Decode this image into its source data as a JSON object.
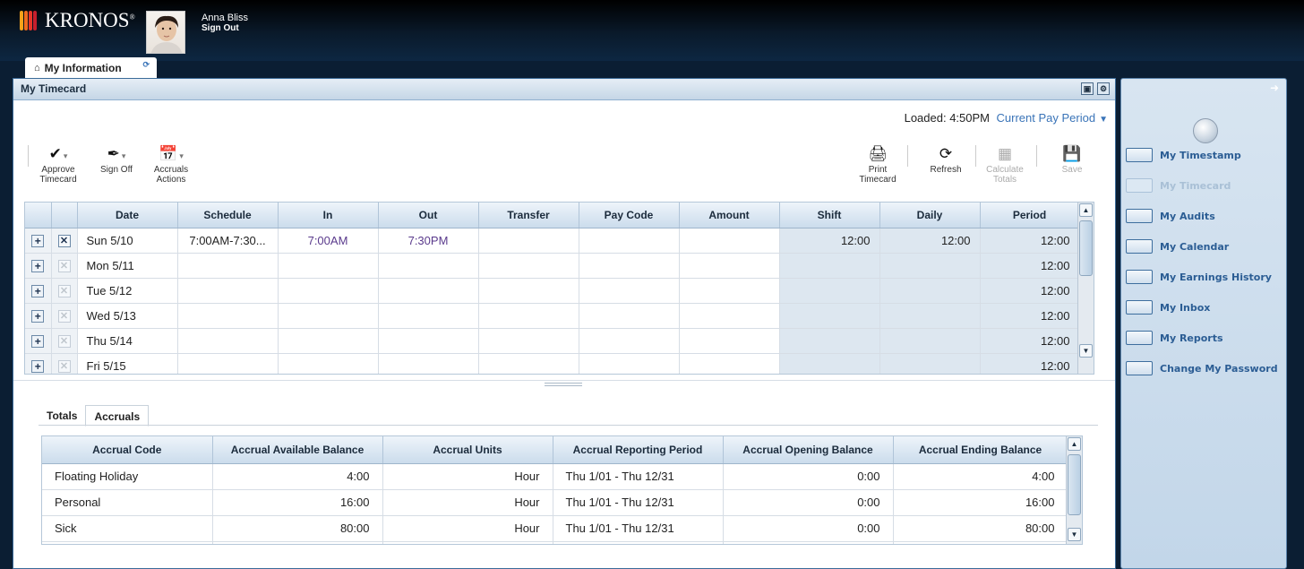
{
  "header": {
    "logo_text": "KRONOS",
    "logo_mark": "®",
    "user_name": "Anna Bliss",
    "sign_out": "Sign Out"
  },
  "workspace_tab": {
    "label": "My Information"
  },
  "frame": {
    "title": "My Timecard",
    "loaded": "Loaded: 4:50PM",
    "period": "Current Pay Period"
  },
  "toolbar": {
    "approve": "Approve Timecard",
    "signoff": "Sign Off",
    "accruals": "Accruals Actions",
    "print": "Print Timecard",
    "refresh": "Refresh",
    "calculate": "Calculate Totals",
    "save": "Save"
  },
  "timecard": {
    "headers": [
      "Date",
      "Schedule",
      "In",
      "Out",
      "Transfer",
      "Pay Code",
      "Amount",
      "Shift",
      "Daily",
      "Period"
    ],
    "rows": [
      {
        "date": "Sun 5/10",
        "schedule": "7:00AM-7:30...",
        "in": "7:00AM",
        "out": "7:30PM",
        "transfer": "",
        "paycode": "",
        "amount": "",
        "shift": "12:00",
        "daily": "12:00",
        "period": "12:00"
      },
      {
        "date": "Mon 5/11",
        "schedule": "",
        "in": "",
        "out": "",
        "transfer": "",
        "paycode": "",
        "amount": "",
        "shift": "",
        "daily": "",
        "period": "12:00"
      },
      {
        "date": "Tue 5/12",
        "schedule": "",
        "in": "",
        "out": "",
        "transfer": "",
        "paycode": "",
        "amount": "",
        "shift": "",
        "daily": "",
        "period": "12:00"
      },
      {
        "date": "Wed 5/13",
        "schedule": "",
        "in": "",
        "out": "",
        "transfer": "",
        "paycode": "",
        "amount": "",
        "shift": "",
        "daily": "",
        "period": "12:00"
      },
      {
        "date": "Thu 5/14",
        "schedule": "",
        "in": "",
        "out": "",
        "transfer": "",
        "paycode": "",
        "amount": "",
        "shift": "",
        "daily": "",
        "period": "12:00"
      },
      {
        "date": "Fri 5/15",
        "schedule": "",
        "in": "",
        "out": "",
        "transfer": "",
        "paycode": "",
        "amount": "",
        "shift": "",
        "daily": "",
        "period": "12:00"
      }
    ]
  },
  "bottom_tabs": {
    "totals": "Totals",
    "accruals": "Accruals"
  },
  "accruals": {
    "headers": [
      "Accrual Code",
      "Accrual Available Balance",
      "Accrual Units",
      "Accrual Reporting Period",
      "Accrual Opening Balance",
      "Accrual Ending Balance"
    ],
    "rows": [
      {
        "code": "Floating Holiday",
        "available": "4:00",
        "units": "Hour",
        "period": "Thu 1/01 - Thu 12/31",
        "opening": "0:00",
        "ending": "4:00"
      },
      {
        "code": "Personal",
        "available": "16:00",
        "units": "Hour",
        "period": "Thu 1/01 - Thu 12/31",
        "opening": "0:00",
        "ending": "16:00"
      },
      {
        "code": "Sick",
        "available": "80:00",
        "units": "Hour",
        "period": "Thu 1/01 - Thu 12/31",
        "opening": "0:00",
        "ending": "80:00"
      }
    ]
  },
  "sidebar": {
    "items": [
      {
        "label": "My Timestamp",
        "active": true
      },
      {
        "label": "My Timecard",
        "active": false
      },
      {
        "label": "My Audits",
        "active": true
      },
      {
        "label": "My Calendar",
        "active": true
      },
      {
        "label": "My Earnings History",
        "active": true
      },
      {
        "label": "My Inbox",
        "active": true
      },
      {
        "label": "My Reports",
        "active": true
      },
      {
        "label": "Change My Password",
        "active": true
      }
    ]
  },
  "colors": {
    "accent": "#3a74b8",
    "header_bg": "#0b1e33",
    "sidebar_bg": "#c9dbec",
    "link": "#2b5d94"
  }
}
